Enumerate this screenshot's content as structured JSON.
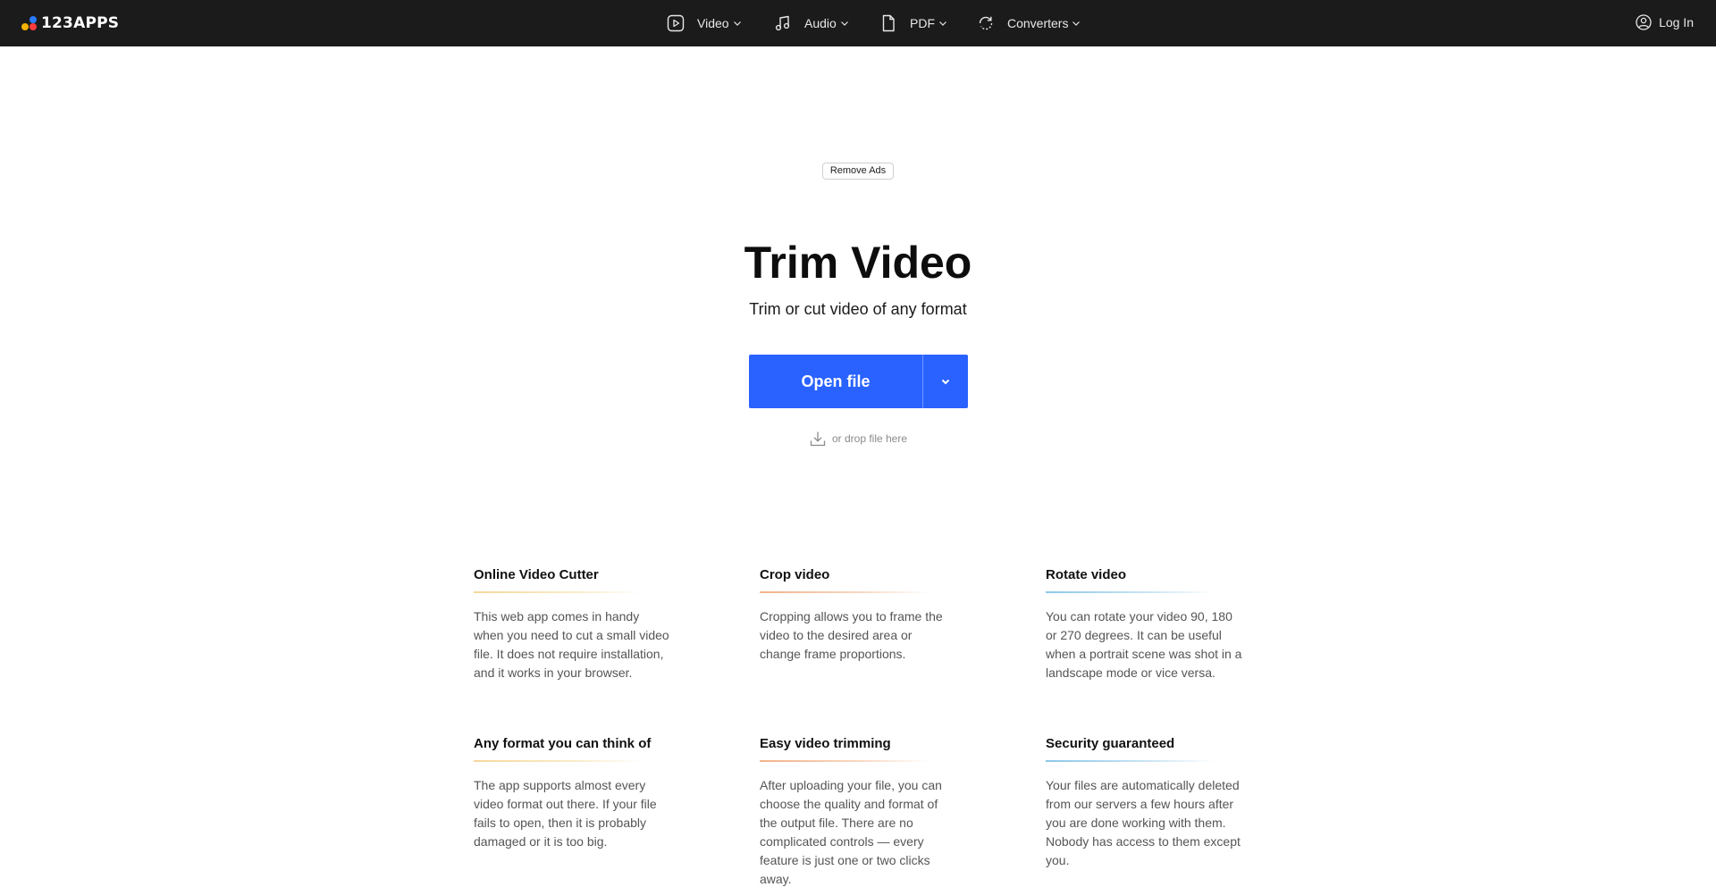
{
  "brand": {
    "name": "123APPS"
  },
  "nav": {
    "items": [
      {
        "label": "Video",
        "icon": "play-square-icon"
      },
      {
        "label": "Audio",
        "icon": "music-note-icon"
      },
      {
        "label": "PDF",
        "icon": "document-icon"
      },
      {
        "label": "Converters",
        "icon": "refresh-icon"
      }
    ],
    "login_label": "Log In"
  },
  "ads": {
    "remove_label": "Remove Ads"
  },
  "hero": {
    "title": "Trim Video",
    "subtitle": "Trim or cut video of any format",
    "open_label": "Open file",
    "drop_hint": "or drop file here"
  },
  "colors": {
    "topbar": "#1b1b1b",
    "primary_button": "#2962ff",
    "logo_blue": "#2a7bff",
    "logo_yellow": "#f5b300",
    "logo_red": "#ff3b3b"
  },
  "features": [
    {
      "title": "Online Video Cutter",
      "text": "This web app comes in handy when you need to cut a small video file. It does not require installation, and it works in your browser."
    },
    {
      "title": "Crop video",
      "text": "Cropping allows you to frame the video to the desired area or change frame proportions."
    },
    {
      "title": "Rotate video",
      "text": "You can rotate your video 90, 180 or 270 degrees. It can be useful when a portrait scene was shot in a landscape mode or vice versa."
    },
    {
      "title": "Any format you can think of",
      "text": "The app supports almost every video format out there. If your file fails to open, then it is probably damaged or it is too big."
    },
    {
      "title": "Easy video trimming",
      "text": "After uploading your file, you can choose the quality and format of the output file. There are no complicated controls — every feature is just one or two clicks away."
    },
    {
      "title": "Security guaranteed",
      "text": "Your files are automatically deleted from our servers a few hours after you are done working with them. Nobody has access to them except you."
    }
  ]
}
